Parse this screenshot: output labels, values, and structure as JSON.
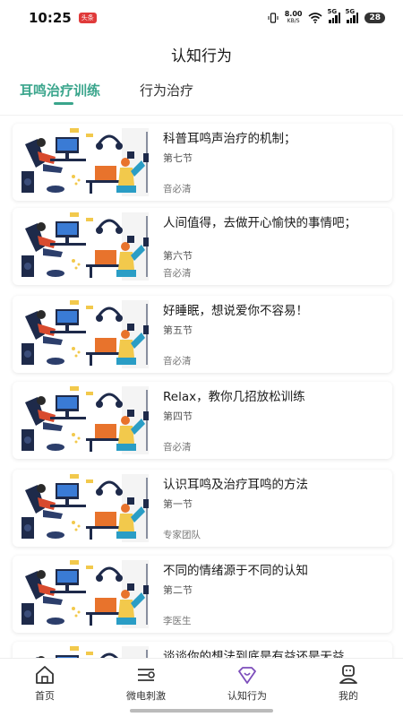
{
  "status_bar": {
    "time": "10:25",
    "tag": "头条",
    "net_speed": "8.00",
    "net_unit": "KB/S",
    "sig1": "5G",
    "sig2": "5G",
    "battery": "28"
  },
  "header": {
    "title": "认知行为"
  },
  "tabs": [
    {
      "label": "耳鸣治疗训练",
      "active": true
    },
    {
      "label": "行为治疗",
      "active": false
    }
  ],
  "courses": [
    {
      "title": "科普耳鸣声治疗的机制；",
      "section": "第七节",
      "author": "音必清"
    },
    {
      "title": "人间值得，去做开心愉快的事情吧；",
      "section": "第六节",
      "author": "音必清"
    },
    {
      "title": "好睡眠，想说爱你不容易！",
      "section": "第五节",
      "author": "音必清"
    },
    {
      "title": "Relax，教你几招放松训练",
      "section": "第四节",
      "author": "音必清"
    },
    {
      "title": "认识耳鸣及治疗耳鸣的方法",
      "section": "第一节",
      "author": "专家团队"
    },
    {
      "title": "不同的情绪源于不同的认知",
      "section": "第二节",
      "author": "李医生"
    },
    {
      "title": "谈谈你的想法到底是有益还是无益",
      "section": "",
      "author": ""
    }
  ],
  "bottom_nav": [
    {
      "label": "首页",
      "icon": "home-icon"
    },
    {
      "label": "微电刺激",
      "icon": "stimulation-icon"
    },
    {
      "label": "认知行为",
      "icon": "diamond-heart-icon",
      "active": true
    },
    {
      "label": "我的",
      "icon": "profile-icon"
    }
  ],
  "colors": {
    "accent": "#3aa58c",
    "active_nav": "#7c4dbb"
  }
}
